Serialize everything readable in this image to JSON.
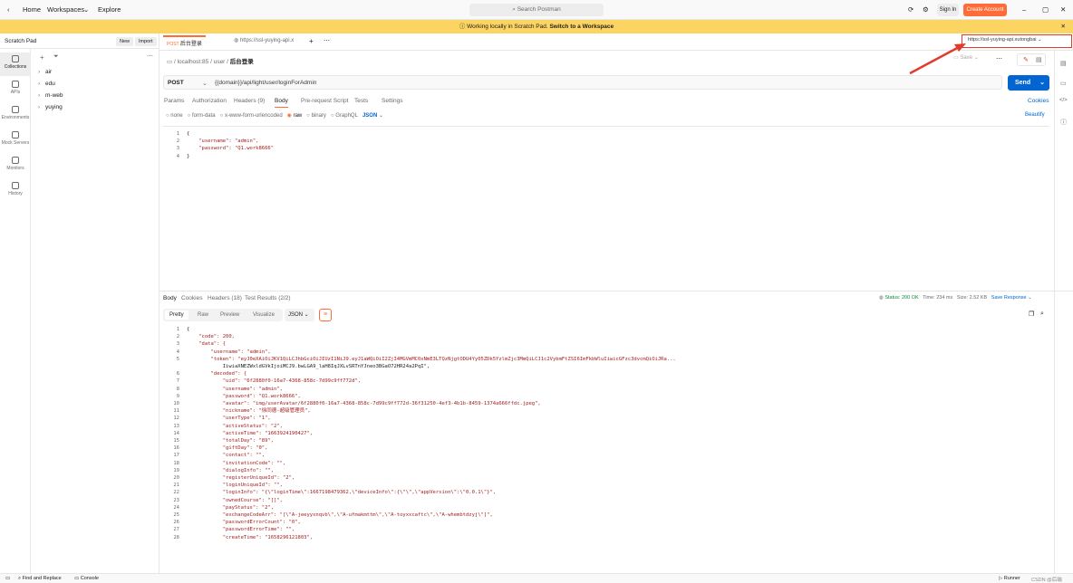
{
  "topbar": {
    "home": "Home",
    "workspaces": "Workspaces",
    "explore": "Explore",
    "search_placeholder": "Search Postman",
    "sign_in": "Sign In",
    "create_account": "Create Account"
  },
  "banner": {
    "text": "Working locally in Scratch Pad.",
    "link": "Switch to a Workspace"
  },
  "sidebar": {
    "title": "Scratch Pad",
    "new_label": "New",
    "import_label": "Import",
    "rail": [
      {
        "label": "Collections"
      },
      {
        "label": "APIs"
      },
      {
        "label": "Environments"
      },
      {
        "label": "Mock Servers"
      },
      {
        "label": "Monitors"
      },
      {
        "label": "History"
      }
    ],
    "collections": [
      "air",
      "edu",
      "m-web",
      "yuying"
    ]
  },
  "tabs": {
    "tab1": "后台登录",
    "tab2": "https://ssl-yuying-api.x",
    "env": "https://ssl-yuying-api.xutongbai"
  },
  "breadcrumb": {
    "host": "localhost:85",
    "seg1": "user",
    "name": "后台登录"
  },
  "request": {
    "method": "POST",
    "url": "{{domain}}/api/light/user/loginForAdmin",
    "send": "Send",
    "save": "Save",
    "tabs": [
      "Params",
      "Authorization",
      "Headers (9)",
      "Body",
      "Pre-request Script",
      "Tests",
      "Settings"
    ],
    "cookies": "Cookies",
    "body_types": [
      "none",
      "form-data",
      "x-www-form-urlencoded",
      "raw",
      "binary",
      "GraphQL"
    ],
    "format": "JSON",
    "beautify": "Beautify",
    "body_lines": [
      {
        "n": "1",
        "text": "{"
      },
      {
        "n": "2",
        "text": "    \"username\": \"admin\","
      },
      {
        "n": "3",
        "text": "    \"password\": \"Q1.work8666\""
      },
      {
        "n": "4",
        "text": "}"
      }
    ]
  },
  "response": {
    "tabs": [
      "Body",
      "Cookies",
      "Headers (18)",
      "Test Results (2/2)"
    ],
    "status": "Status: 200 OK",
    "time": "Time: 234 ms",
    "size": "Size: 2.52 KB",
    "save_response": "Save Response",
    "views": [
      "Pretty",
      "Raw",
      "Preview",
      "Visualize"
    ],
    "format": "JSON",
    "lines": [
      {
        "n": "1",
        "text": "{"
      },
      {
        "n": "2",
        "text": "    \"code\": 200,"
      },
      {
        "n": "3",
        "text": "    \"data\": {"
      },
      {
        "n": "4",
        "text": "        \"username\": \"admin\","
      },
      {
        "n": "5",
        "text": "        \"token\": \"eyJ0eXAiOiJKV1QiLCJhbGciOiJIUzI1NiJ9.eyJ1aWQiOiI2ZjI4MGVmMC0xNmE3LTQzNjgtODU4Yy05ZDk5YzlmZjc3MmQiLCJ1c2VybmFtZSI6ImFkbWluIiwicGFzc3dvcmQiOiJRa..."
      },
      {
        "n": "",
        "text": "            IiwiaXNEZWxldGVkIjoiMCJ9.bwLGA9_laH8IqJXLvSRTnYJneo3BGaO72HR24a2PqI\","
      },
      {
        "n": "6",
        "text": "        \"decoded\": {"
      },
      {
        "n": "7",
        "text": "            \"uid\": \"6f2880f0-16a7-4368-858c-7d99c9ff772d\","
      },
      {
        "n": "8",
        "text": "            \"username\": \"admin\","
      },
      {
        "n": "9",
        "text": "            \"password\": \"Q1.work8666\","
      },
      {
        "n": "10",
        "text": "            \"avatar\": \"img/userAvatar/6f2880f0-16a7-4368-858c-7d99c9ff772d-36f31250-4ef3-4b1b-8459-1374a666ffdc.jpeg\","
      },
      {
        "n": "11",
        "text": "            \"nickname\": \"徐同德-超级管理员\","
      },
      {
        "n": "12",
        "text": "            \"userType\": \"1\","
      },
      {
        "n": "13",
        "text": "            \"activeStatus\": \"2\","
      },
      {
        "n": "14",
        "text": "            \"activeTime\": \"1663924190427\","
      },
      {
        "n": "15",
        "text": "            \"totalDay\": \"89\","
      },
      {
        "n": "16",
        "text": "            \"giftDay\": \"0\","
      },
      {
        "n": "17",
        "text": "            \"contact\": \"\","
      },
      {
        "n": "18",
        "text": "            \"invitationCode\": \"\","
      },
      {
        "n": "19",
        "text": "            \"dialogInfo\": \"\","
      },
      {
        "n": "20",
        "text": "            \"registerUniqueId\": \"2\","
      },
      {
        "n": "21",
        "text": "            \"loginUniqueId\": \"\","
      },
      {
        "n": "22",
        "text": "            \"loginInfo\": \"{\\\"loginTime\\\":1667198479362,\\\"deviceInfo\\\":{\\\"\\\",\\\"appVersion\\\":\\\"0.0.1\\\"}\","
      },
      {
        "n": "23",
        "text": "            \"ownedCourse\": \"[]\","
      },
      {
        "n": "24",
        "text": "            \"payStatus\": \"2\","
      },
      {
        "n": "25",
        "text": "            \"exchangeCodeArr\": \"[\\\"A-jeeyyxnqvb\\\",\\\"A-ufmakmttm\\\",\\\"A-toyxxcaftc\\\",\\\"A-whembtdzyj\\\"]\","
      },
      {
        "n": "26",
        "text": "            \"passwordErrorCount\": \"0\","
      },
      {
        "n": "27",
        "text": "            \"passwordErrorTime\": \"\","
      },
      {
        "n": "28",
        "text": "            \"createTime\": \"1658296121803\","
      }
    ]
  },
  "footer": {
    "find_replace": "Find and Replace",
    "console": "Console",
    "runner": "Runner",
    "watermark": "CSDN @后端"
  },
  "colors": {
    "accent": "#ff6c37",
    "send": "#0265d2",
    "banner": "#fcd462",
    "annotation": "#e13b2b"
  }
}
